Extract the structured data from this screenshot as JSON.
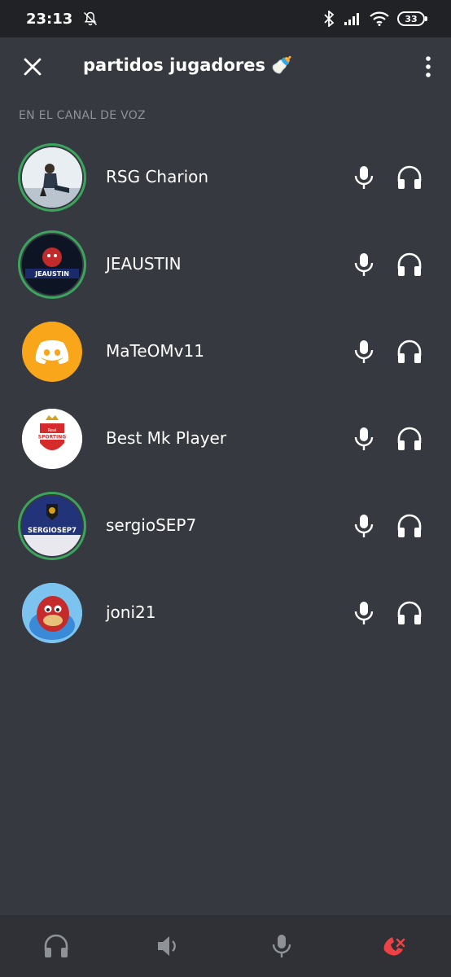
{
  "status_bar": {
    "time": "23:13",
    "battery": "33"
  },
  "header": {
    "title": "partidos jugadores 🍼"
  },
  "section": {
    "label": "EN EL CANAL DE VOZ"
  },
  "members": [
    {
      "name": "RSG Charion",
      "speaking": true
    },
    {
      "name": "JEAUSTIN",
      "speaking": true
    },
    {
      "name": "MaTeOMv11",
      "speaking": false
    },
    {
      "name": "Best Mk Player",
      "speaking": false
    },
    {
      "name": "sergioSEP7",
      "speaking": true
    },
    {
      "name": "joni21",
      "speaking": false
    }
  ],
  "avatars": {
    "jeaustin_text": "JEAUSTIN",
    "sporting_text": "SPORTING",
    "sporting_small": "Real",
    "sergio_text": "SERGIOSEP7"
  },
  "colors": {
    "background": "#36393f",
    "speaking_ring": "#3ba55d",
    "discord_default_avatar": "#faa61a",
    "hangup": "#ed4245"
  },
  "bottom_bar": {
    "icons": [
      "headset-icon",
      "speaker-icon",
      "microphone-icon",
      "hangup-icon"
    ]
  }
}
